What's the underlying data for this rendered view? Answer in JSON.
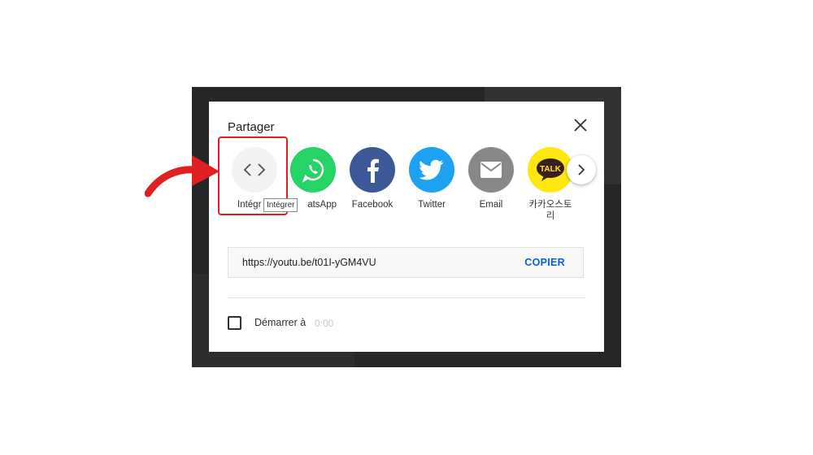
{
  "dialog": {
    "title": "Partager",
    "share_items": [
      {
        "label": "Intégrer",
        "icon": "embed-code-icon",
        "color": "#f2f2f2"
      },
      {
        "label": "WhatsApp",
        "icon": "whatsapp-icon",
        "color": "#25d366"
      },
      {
        "label": "Facebook",
        "icon": "facebook-icon",
        "color": "#3b5998"
      },
      {
        "label": "Twitter",
        "icon": "twitter-icon",
        "color": "#1da1f2"
      },
      {
        "label": "Email",
        "icon": "email-icon",
        "color": "#888888"
      },
      {
        "label": "카카오스토리",
        "icon": "kakaotalk-icon",
        "color": "#ffe812"
      }
    ],
    "visible_labels": {
      "embed_partial": "Intégr",
      "whatsapp_partial": "atsApp"
    },
    "tooltip": "Intégrer",
    "url": "https://youtu.be/t01I-yGM4VU",
    "copy_label": "COPIER",
    "start_label": "Démarrer à",
    "start_time": "0:00",
    "kakao_badge": "TALK"
  },
  "colors": {
    "highlight": "#e02020",
    "arrow": "#e02020",
    "link": "#065fd4"
  }
}
